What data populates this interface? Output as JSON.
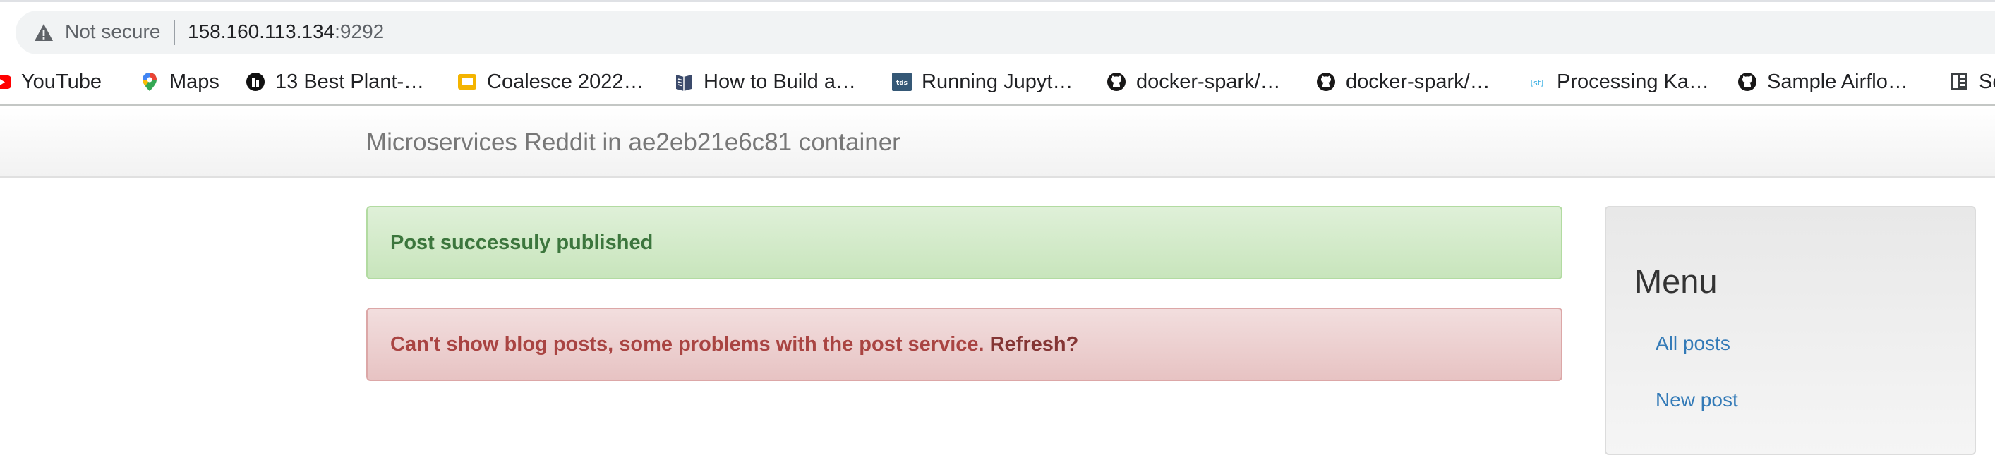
{
  "browser": {
    "security_label": "Not secure",
    "url_host": "158.160.113.134",
    "url_port": ":9292"
  },
  "bookmarks": [
    {
      "label": "YouTube",
      "icon": "youtube-icon"
    },
    {
      "label": "Maps",
      "icon": "maps-pin-icon"
    },
    {
      "label": "13 Best Plant-…",
      "icon": "site-icon"
    },
    {
      "label": "Coalesce 2022…",
      "icon": "slides-icon"
    },
    {
      "label": "How to Build a…",
      "icon": "book-icon"
    },
    {
      "label": "Running Jupyt…",
      "icon": "tds-icon"
    },
    {
      "label": "docker-spark/…",
      "icon": "github-icon"
    },
    {
      "label": "docker-spark/…",
      "icon": "github-icon"
    },
    {
      "label": "Processing Ka…",
      "icon": "site-icon"
    },
    {
      "label": "Sample Airflo…",
      "icon": "github-icon"
    },
    {
      "label": "Sc",
      "icon": "docs-icon"
    }
  ],
  "navbar": {
    "brand": "Microservices Reddit in ae2eb21e6c81 container"
  },
  "alerts": {
    "success": "Post successuly published",
    "danger": "Can't show blog posts, some problems with the post service.",
    "danger_link": "Refresh?"
  },
  "menu": {
    "title": "Menu",
    "items": [
      "All posts",
      "New post"
    ]
  },
  "colors": {
    "success_text": "#3c763d",
    "danger_text": "#a94442",
    "link": "#337ab7"
  }
}
